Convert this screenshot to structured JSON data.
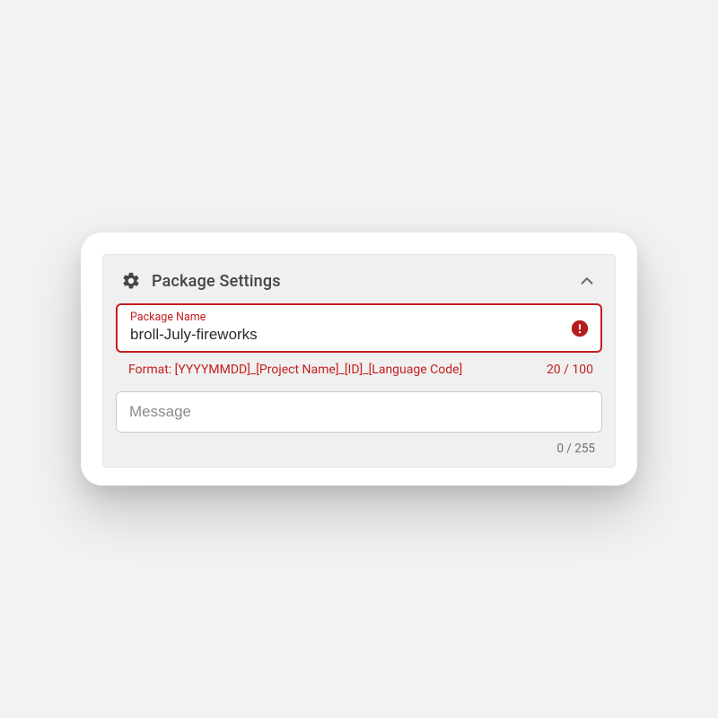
{
  "panel": {
    "title": "Package Settings"
  },
  "packageName": {
    "label": "Package Name",
    "value": "broll-July-fireworks",
    "hint": "Format: [YYYYMMDD]_[Project Name]_[ID]_[Language Code]",
    "count": "20 / 100"
  },
  "message": {
    "placeholder": "Message",
    "value": "",
    "count": "0 / 255"
  }
}
